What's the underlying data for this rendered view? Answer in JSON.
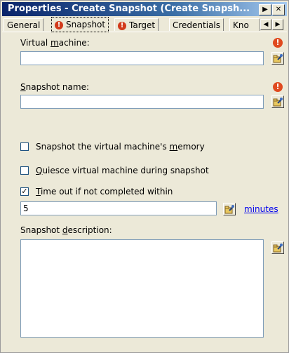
{
  "window": {
    "title": "Properties - Create Snapshot (Create Snapsh...",
    "nav_right_glyph": "▶",
    "close_glyph": "✕"
  },
  "tabs": [
    {
      "label": "General",
      "warning": false,
      "active": false
    },
    {
      "label": "Snapshot",
      "warning": true,
      "active": true
    },
    {
      "label": "Target",
      "warning": true,
      "active": false
    },
    {
      "label": "Credentials",
      "warning": false,
      "active": false
    },
    {
      "label": "Kno",
      "warning": false,
      "active": false
    }
  ],
  "tab_scroll": {
    "left": "◀",
    "right": "▶"
  },
  "warning_glyph": "!",
  "form": {
    "vm_label_pre": "Virtual ",
    "vm_label_u": "m",
    "vm_label_post": "achine:",
    "vm_value": "",
    "snap_label_u": "S",
    "snap_label_post": "napshot name:",
    "snap_value": "",
    "memory_pre": "Snapshot the virtual machine's ",
    "memory_u": "m",
    "memory_post": "emory",
    "memory_checked": false,
    "quiesce_u": "Q",
    "quiesce_post": "uiesce virtual machine during snapshot",
    "quiesce_checked": false,
    "timeout_u": "T",
    "timeout_post": "ime out if not completed within",
    "timeout_checked": true,
    "timeout_value": "5",
    "minutes_link": "minutes",
    "desc_label_pre": "Snapshot ",
    "desc_label_u": "d",
    "desc_label_post": "escription:",
    "desc_value": ""
  }
}
